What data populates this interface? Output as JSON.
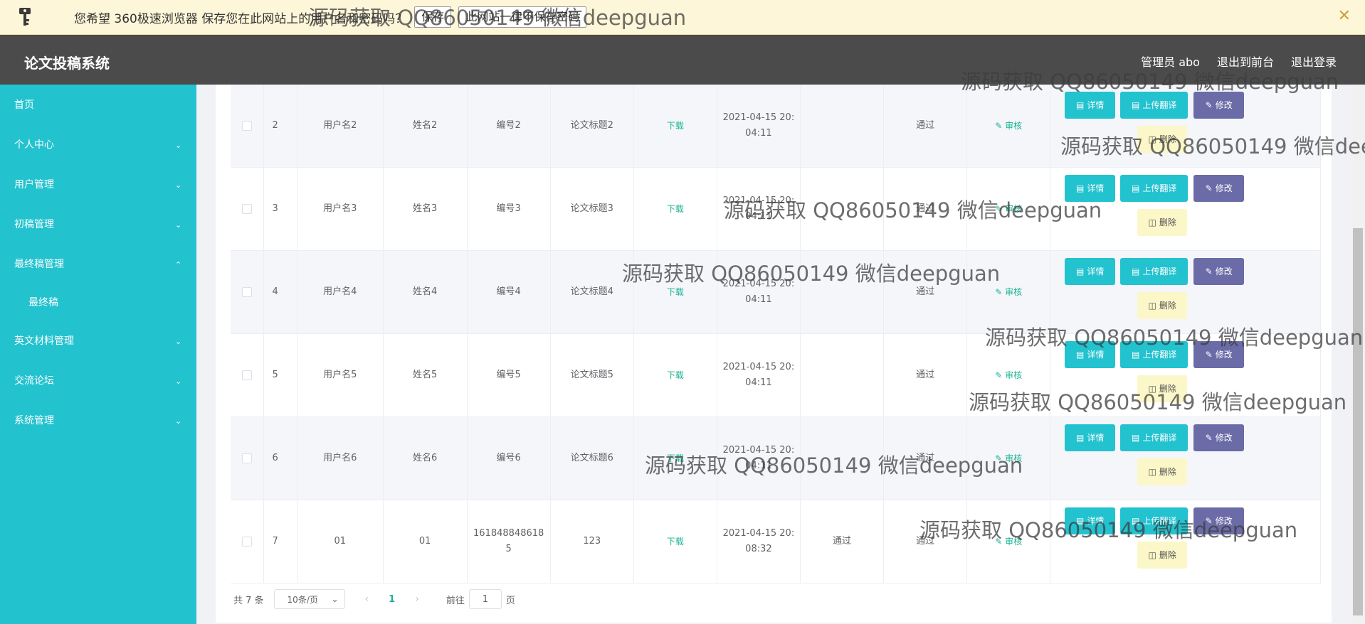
{
  "browser_bar": {
    "message": "您希望 360极速浏览器 保存您在此网站上的用户名和密码吗？",
    "save_label": "保存",
    "never_label": "此网站一律不保存密码",
    "close_glyph": "✕",
    "icon": "key-icon"
  },
  "header": {
    "title": "论文投稿系统",
    "nav": [
      "管理员 abo",
      "退出到前台",
      "退出登录"
    ]
  },
  "sidebar": {
    "items": [
      {
        "label": "首页",
        "expandable": false
      },
      {
        "label": "个人中心",
        "expandable": true
      },
      {
        "label": "用户管理",
        "expandable": true
      },
      {
        "label": "初稿管理",
        "expandable": true
      },
      {
        "label": "最终稿管理",
        "expandable": true,
        "open": true,
        "children": [
          "最终稿"
        ]
      },
      {
        "label": "英文材料管理",
        "expandable": true
      },
      {
        "label": "交流论坛",
        "expandable": true
      },
      {
        "label": "系统管理",
        "expandable": true
      }
    ]
  },
  "table": {
    "rows": [
      {
        "no": "2",
        "user": "用户名2",
        "name": "姓名2",
        "code": "编号2",
        "title": "论文标题2",
        "file": "下载",
        "time": "2021-04-15 20:04:11",
        "status1": "",
        "status2": "通过",
        "audit": "审核"
      },
      {
        "no": "3",
        "user": "用户名3",
        "name": "姓名3",
        "code": "编号3",
        "title": "论文标题3",
        "file": "下载",
        "time": "2021-04-15 20:04:11",
        "status1": "",
        "status2": "通过",
        "audit": "审核"
      },
      {
        "no": "4",
        "user": "用户名4",
        "name": "姓名4",
        "code": "编号4",
        "title": "论文标题4",
        "file": "下载",
        "time": "2021-04-15 20:04:11",
        "status1": "",
        "status2": "通过",
        "audit": "审核"
      },
      {
        "no": "5",
        "user": "用户名5",
        "name": "姓名5",
        "code": "编号5",
        "title": "论文标题5",
        "file": "下载",
        "time": "2021-04-15 20:04:11",
        "status1": "",
        "status2": "通过",
        "audit": "审核"
      },
      {
        "no": "6",
        "user": "用户名6",
        "name": "姓名6",
        "code": "编号6",
        "title": "论文标题6",
        "file": "下载",
        "time": "2021-04-15 20:04:11",
        "status1": "",
        "status2": "通过",
        "audit": "审核"
      },
      {
        "no": "7",
        "user": "01",
        "name": "01",
        "code": "1618488486185",
        "title": "123",
        "file": "下载",
        "time": "2021-04-15 20:08:32",
        "status1": "通过",
        "status2": "通过",
        "audit": "审核"
      }
    ],
    "actions": {
      "detail": "详情",
      "upload": "上传翻译",
      "edit": "修改",
      "delete": "删除"
    }
  },
  "pager": {
    "total": "共 7 条",
    "page_size": "10条/页",
    "prev": "‹",
    "current": "1",
    "next": "›",
    "goto_label": "前往",
    "goto_value": "1",
    "page_unit": "页"
  },
  "watermark": "源码获取 QQ86050149 微信deepguan",
  "colors": {
    "sidebar": "#23c2cf",
    "header": "#4b4b4b",
    "accent_green": "#1ab394",
    "edit_button": "#6b6ba8",
    "delete_button": "#fbf7c8"
  }
}
